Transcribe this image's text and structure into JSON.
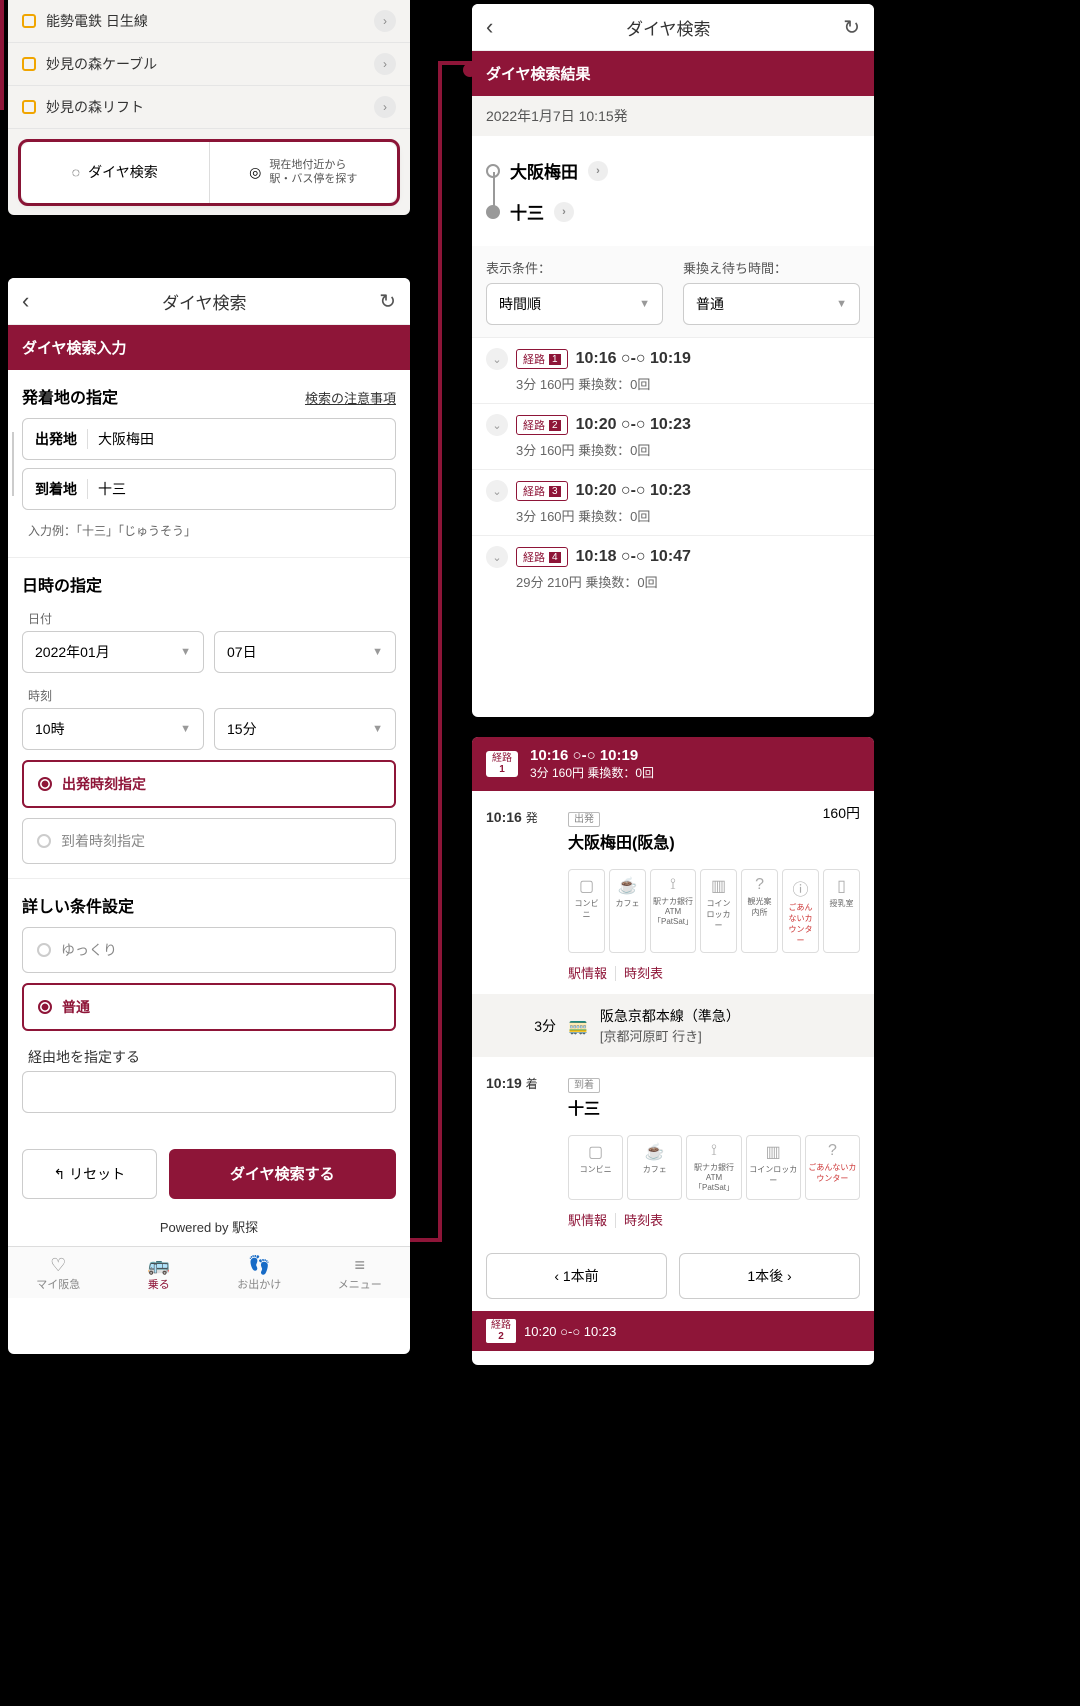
{
  "s1": {
    "lines": [
      "能勢電鉄 日生線",
      "妙見の森ケーブル",
      "妙見の森リフト"
    ],
    "btn_diagram": "ダイヤ検索",
    "btn_nearby": "現在地付近から\n駅・バス停を探す"
  },
  "s2": {
    "title": "ダイヤ検索",
    "bar": "ダイヤ検索入力",
    "origdest": {
      "heading": "発着地の指定",
      "note_link": "検索の注意事項",
      "dep_lbl": "出発地",
      "dep_val": "大阪梅田",
      "arr_lbl": "到着地",
      "arr_val": "十三",
      "hint": "入力例：「十三」「じゅうそう」"
    },
    "datetime": {
      "heading": "日時の指定",
      "date_lbl": "日付",
      "month": "2022年01月",
      "day": "07日",
      "time_lbl": "時刻",
      "hour": "10時",
      "min": "15分",
      "opt_dep": "出発時刻指定",
      "opt_arr": "到着時刻指定"
    },
    "detail": {
      "heading": "詳しい条件設定",
      "slow": "ゆっくり",
      "normal": "普通",
      "via_lbl": "経由地を指定する"
    },
    "reset": "リセット",
    "search": "ダイヤ検索する",
    "powered": "Powered by 駅探",
    "tabs": [
      "マイ阪急",
      "乗る",
      "お出かけ",
      "メニュー"
    ]
  },
  "s3": {
    "title": "ダイヤ検索",
    "bar": "ダイヤ検索結果",
    "timestamp": "2022年1月7日 10:15発",
    "from": "大阪梅田",
    "to": "十三",
    "filter1_lbl": "表示条件：",
    "filter1": "時間順",
    "filter2_lbl": "乗換え待ち時間：",
    "filter2": "普通",
    "routes": [
      {
        "n": "1",
        "t": "10:16 ○-○ 10:19",
        "m": "3分 160円 乗換数：0回"
      },
      {
        "n": "2",
        "t": "10:20 ○-○ 10:23",
        "m": "3分 160円 乗換数：0回"
      },
      {
        "n": "3",
        "t": "10:20 ○-○ 10:23",
        "m": "3分 160円 乗換数：0回"
      },
      {
        "n": "4",
        "t": "10:18 ○-○ 10:47",
        "m": "29分 210円 乗換数：0回"
      }
    ],
    "route_label": "経路"
  },
  "s4": {
    "hdr_badge": "経路",
    "hdr_n": "1",
    "hdr_time": "10:16 ○-○ 10:19",
    "hdr_meta": "3分 160円 乗換数：0回",
    "dep_time": "10:16",
    "dep_sfx": "発",
    "dep_tag": "出発",
    "dep_station": "大阪梅田(阪急)",
    "price": "160円",
    "mid_dur": "3分",
    "mid_line": "阪急京都本線（準急）",
    "mid_dest": "[京都河原町 行き]",
    "arr_time": "10:19",
    "arr_sfx": "着",
    "arr_tag": "到着",
    "arr_station": "十三",
    "icons1": [
      "コンビニ",
      "カフェ",
      "駅ナカ銀行ATM「PatSat」",
      "コインロッカー",
      "観光案内所",
      "ごあんないカウンター",
      "授乳室"
    ],
    "icons2": [
      "コンビニ",
      "カフェ",
      "駅ナカ銀行ATM「PatSat」",
      "コインロッカー",
      "ごあんないカウンター"
    ],
    "link_info": "駅情報",
    "link_tt": "時刻表",
    "prev": "1本前",
    "next": "1本後",
    "footer_time": "10:20 ○-○ 10:23",
    "footer_n": "2"
  }
}
